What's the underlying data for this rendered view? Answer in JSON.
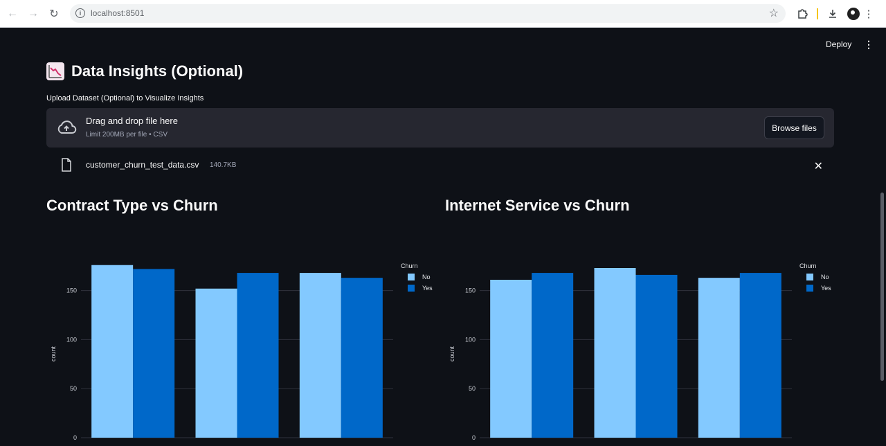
{
  "browser": {
    "url": "localhost:8501"
  },
  "header": {
    "deploy_label": "Deploy",
    "menu_icon": "kebab-menu-icon"
  },
  "page": {
    "title": "Data Insights (Optional)",
    "title_icon": "chart-decreasing-icon"
  },
  "uploader": {
    "label": "Upload Dataset (Optional) to Visualize Insights",
    "drop_title": "Drag and drop file here",
    "drop_subtitle": "Limit 200MB per file • CSV",
    "browse_label": "Browse files"
  },
  "uploaded_file": {
    "name": "customer_churn_test_data.csv",
    "size": "140.7KB"
  },
  "colors": {
    "background": "#0e1117",
    "no_bar": "#83c9ff",
    "yes_bar": "#0068c9",
    "dropzone": "#262730"
  },
  "charts": [
    {
      "title": "Contract Type vs Churn"
    },
    {
      "title": "Internet Service vs Churn"
    }
  ],
  "chart_data": [
    {
      "type": "bar",
      "title": "Contract Type vs Churn",
      "xlabel": "",
      "ylabel": "count",
      "ylim": [
        0,
        185
      ],
      "yticks": [
        0,
        50,
        100,
        150
      ],
      "categories": [
        "",
        "",
        ""
      ],
      "legend_title": "Churn",
      "legend_position": "top-right",
      "grid": true,
      "series": [
        {
          "name": "No",
          "color": "#83c9ff",
          "values": [
            176,
            152,
            168
          ]
        },
        {
          "name": "Yes",
          "color": "#0068c9",
          "values": [
            172,
            168,
            163
          ]
        }
      ]
    },
    {
      "type": "bar",
      "title": "Internet Service vs Churn",
      "xlabel": "",
      "ylabel": "count",
      "ylim": [
        0,
        185
      ],
      "yticks": [
        0,
        50,
        100,
        150
      ],
      "categories": [
        "",
        "",
        ""
      ],
      "legend_title": "Churn",
      "legend_position": "top-right",
      "grid": true,
      "series": [
        {
          "name": "No",
          "color": "#83c9ff",
          "values": [
            161,
            173,
            163
          ]
        },
        {
          "name": "Yes",
          "color": "#0068c9",
          "values": [
            168,
            166,
            168
          ]
        }
      ]
    }
  ]
}
